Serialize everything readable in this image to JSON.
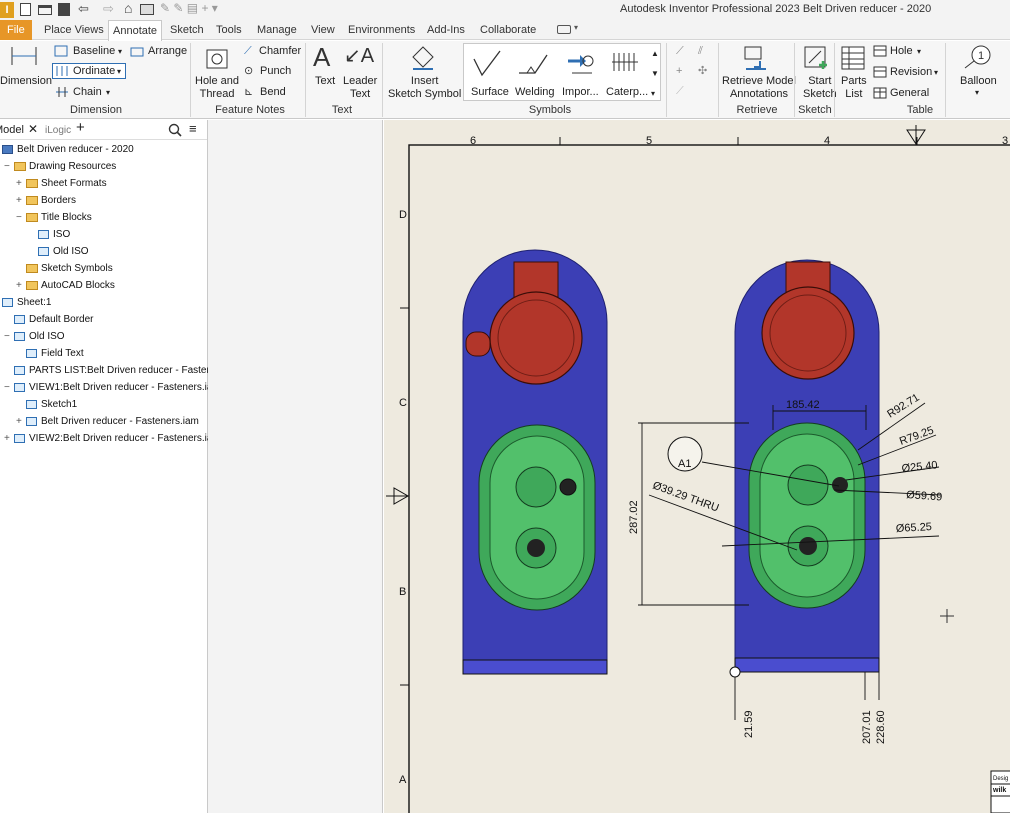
{
  "app": {
    "title": "Autodesk Inventor Professional 2023   Belt Driven reducer - 2020"
  },
  "tabs": [
    {
      "label": "File"
    },
    {
      "label": "Place Views"
    },
    {
      "label": "Annotate"
    },
    {
      "label": "Sketch"
    },
    {
      "label": "Tools"
    },
    {
      "label": "Manage"
    },
    {
      "label": "View"
    },
    {
      "label": "Environments"
    },
    {
      "label": "Add-Ins"
    },
    {
      "label": "Collaborate"
    }
  ],
  "ribbon": {
    "dimension": {
      "main": "Dimension",
      "baseline": "Baseline",
      "arrange": "Arrange",
      "ordinate": "Ordinate",
      "chain": "Chain",
      "group": "Dimension"
    },
    "feature_notes": {
      "hole_thread": "Hole and\nThread",
      "chamfer": "Chamfer",
      "punch": "Punch",
      "bend": "Bend",
      "group": "Feature Notes"
    },
    "text": {
      "text": "Text",
      "leader": "Leader\nText",
      "group": "Text"
    },
    "symbols": {
      "insert": "Insert\nSketch Symbol",
      "surface": "Surface",
      "welding": "Welding",
      "import": "Impor...",
      "caterpillar": "Caterp...",
      "group": "Symbols"
    },
    "retrieve": {
      "retrieve": "Retrieve Model\nAnnotations",
      "group": "Retrieve"
    },
    "sketch": {
      "start": "Start\nSketch",
      "group": "Sketch"
    },
    "table": {
      "parts_list": "Parts\nList",
      "hole": "Hole",
      "revision": "Revision",
      "general": "General",
      "group": "Table"
    },
    "balloon": {
      "label": "Balloon"
    }
  },
  "browser": {
    "tabs": {
      "model": "Model",
      "ilogic": "iLogic"
    },
    "tree": [
      {
        "label": "Belt Driven reducer - 2020",
        "level": 0,
        "icon": "drawing-icon",
        "toggle": ""
      },
      {
        "label": "Drawing Resources",
        "level": 1,
        "icon": "folder-icon",
        "toggle": "−"
      },
      {
        "label": "Sheet Formats",
        "level": 2,
        "icon": "folder-icon",
        "toggle": "+"
      },
      {
        "label": "Borders",
        "level": 2,
        "icon": "folder-icon",
        "toggle": "+"
      },
      {
        "label": "Title Blocks",
        "level": 2,
        "icon": "folder-icon",
        "toggle": "−"
      },
      {
        "label": "ISO",
        "level": 3,
        "icon": "titleblock-icon",
        "toggle": ""
      },
      {
        "label": "Old ISO",
        "level": 3,
        "icon": "titleblock-icon",
        "toggle": ""
      },
      {
        "label": "Sketch Symbols",
        "level": 2,
        "icon": "folder-icon",
        "toggle": ""
      },
      {
        "label": "AutoCAD Blocks",
        "level": 2,
        "icon": "folder-icon",
        "toggle": "+"
      },
      {
        "label": "Sheet:1",
        "level": 0,
        "icon": "sheet-icon",
        "toggle": "−"
      },
      {
        "label": "Default Border",
        "level": 1,
        "icon": "titleblock-icon",
        "toggle": ""
      },
      {
        "label": "Old ISO",
        "level": 1,
        "icon": "titleblock-icon",
        "toggle": "−"
      },
      {
        "label": "Field Text",
        "level": 2,
        "icon": "field-text-icon",
        "toggle": ""
      },
      {
        "label": "PARTS LIST:Belt Driven reducer - Fastene",
        "level": 1,
        "icon": "table-icon",
        "toggle": ""
      },
      {
        "label": "VIEW1:Belt Driven reducer - Fasteners.ia",
        "level": 1,
        "icon": "view-icon",
        "toggle": "−"
      },
      {
        "label": "Sketch1",
        "level": 2,
        "icon": "sketch-icon",
        "toggle": ""
      },
      {
        "label": "Belt Driven reducer - Fasteners.iam",
        "level": 2,
        "icon": "assembly-icon",
        "toggle": "+"
      },
      {
        "label": "VIEW2:Belt Driven reducer - Fasteners.ia",
        "level": 1,
        "icon": "view-icon",
        "toggle": "+"
      }
    ]
  },
  "sheet": {
    "zones_top": [
      "6",
      "5",
      "4",
      "3"
    ],
    "zones_left": [
      "D",
      "C",
      "B",
      "A"
    ],
    "dimensions": {
      "width": "185.42",
      "height": "287.02",
      "r1": "R92.71",
      "r2": "R79.25",
      "d1": "Ø25.40",
      "d2": "Ø59.69",
      "d3": "Ø65.25",
      "thru": "Ø39.29 THRU",
      "balloon": "A1",
      "ord1": "21.59",
      "ord2": "207.01",
      "ord3": "228.60"
    },
    "titleblock": {
      "line1": "Desig",
      "line2": "wilk"
    }
  },
  "colors": {
    "file_tab": "#e79627",
    "body": "#3c3fb5",
    "motor": "#b2362a",
    "gear": "#3fa85a",
    "paper": "#eeeadf"
  }
}
